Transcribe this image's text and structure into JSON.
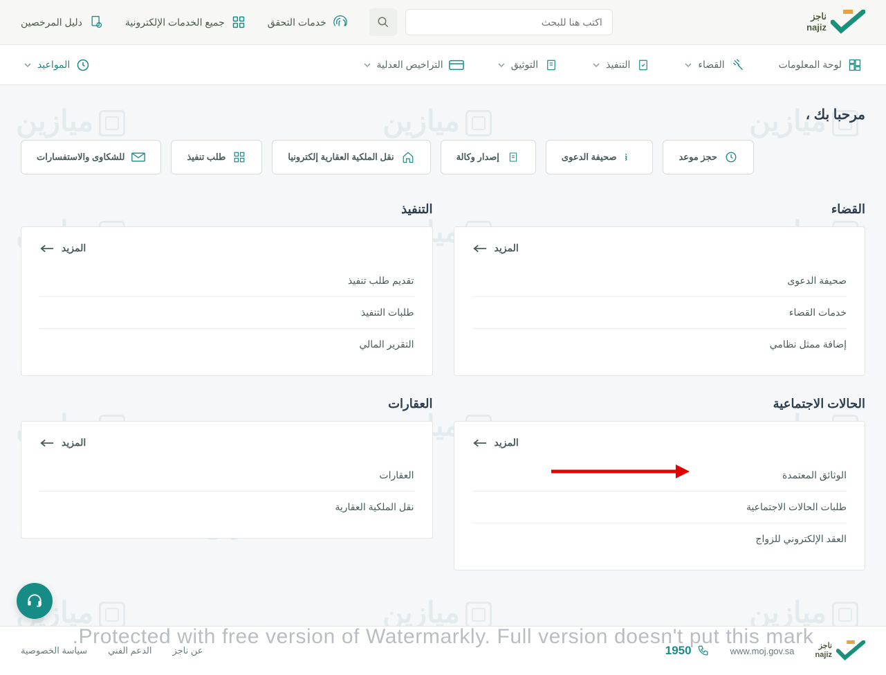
{
  "brand": {
    "name_ar": "ناجز",
    "name_en": "najiz"
  },
  "search": {
    "placeholder": "اكتب هنا للبحث"
  },
  "top_links": {
    "verify": "خدمات التحقق",
    "all_services": "جميع الخدمات الإلكترونية",
    "licensed_guide": "دليل المرخصين"
  },
  "nav": {
    "dashboard": "لوحة المعلومات",
    "judiciary": "القضاء",
    "execution": "التنفيذ",
    "notary": "التوثيق",
    "licenses": "التراخيص العدلية",
    "appointments": "المواعيد"
  },
  "welcome": "مرحبا بك ،",
  "quick": {
    "book_appointment": "حجز موعد",
    "case_sheet": "صحيفة الدعوى",
    "issue_poa": "إصدار وكالة",
    "property_transfer": "نقل الملكية العقارية إلكترونيا",
    "exec_request": "طلب تنفيذ",
    "complaints": "للشكاوى والاستفسارات"
  },
  "more_label": "المزيد",
  "sections": {
    "judiciary": {
      "title": "القضاء",
      "items": [
        "صحيفة الدعوى",
        "خدمات القضاء",
        "إضافة ممثل نظامي"
      ]
    },
    "execution": {
      "title": "التنفيذ",
      "items": [
        "تقديم طلب تنفيذ",
        "طلبات التنفيذ",
        "التقرير المالي"
      ]
    },
    "social": {
      "title": "الحالات الاجتماعية",
      "items": [
        "الوثائق المعتمدة",
        "طلبات الحالات الاجتماعية",
        "العقد الإلكتروني للزواج"
      ]
    },
    "realestate": {
      "title": "العقارات",
      "items": [
        "العقارات",
        "نقل الملكية العقارية"
      ]
    }
  },
  "footer": {
    "phone": "1950",
    "site": "www.moj.gov.sa",
    "links": [
      "عن ناجز",
      "الدعم الفني",
      "سياسة الخصوصية"
    ]
  },
  "overlay_watermark": "Protected with free version of Watermarkly. Full version doesn't put this mark.",
  "bg_watermark_word": "ميازين"
}
